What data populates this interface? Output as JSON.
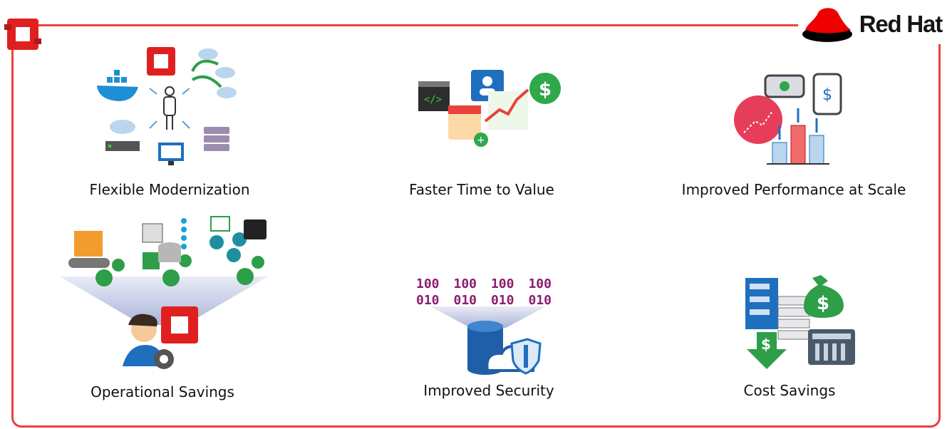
{
  "brand": {
    "name": "Red Hat"
  },
  "benefits": [
    {
      "label": "Flexible Modernization",
      "icon": "modernization-icon"
    },
    {
      "label": "Faster Time to Value",
      "icon": "time-to-value-icon"
    },
    {
      "label": "Improved Performance at Scale",
      "icon": "performance-scale-icon"
    },
    {
      "label": "Operational Savings",
      "icon": "operational-savings-icon"
    },
    {
      "label": "Improved Security",
      "icon": "security-icon"
    },
    {
      "label": "Cost Savings",
      "icon": "cost-savings-icon"
    }
  ],
  "security_bits": [
    "100",
    "100",
    "100",
    "100",
    "010",
    "010",
    "010",
    "010"
  ],
  "colors": {
    "accent": "#e8433b",
    "logo_red": "#ee0000",
    "green": "#3aa83a",
    "blue": "#1f6fbf"
  }
}
